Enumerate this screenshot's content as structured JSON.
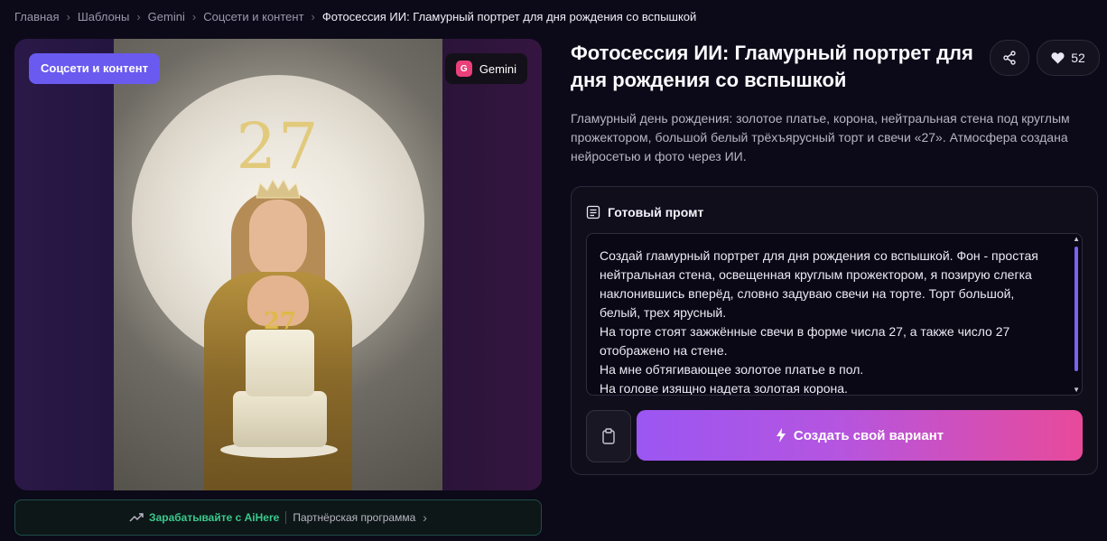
{
  "breadcrumb": {
    "items": [
      "Главная",
      "Шаблоны",
      "Gemini",
      "Соцсети и контент"
    ],
    "current": "Фотосессия ИИ: Гламурный портрет для дня рождения со вспышкой"
  },
  "media": {
    "category_badge": "Соцсети и контент",
    "model_icon_letter": "G",
    "model_name": "Gemini",
    "wall_number": "27",
    "candle_number": "27"
  },
  "affiliate": {
    "link": "Зарабатывайте с AiHere",
    "program": "Партнёрская программа"
  },
  "template": {
    "title": "Фотосессия ИИ: Гламурный портрет для дня рождения со вспышкой",
    "likes": "52",
    "description": "Гламурный день рождения: золотое платье, корона, нейтральная стена под круглым прожектором, большой белый трёхъярусный торт и свечи «27». Атмосфера создана нейросетью и фото через ИИ."
  },
  "prompt": {
    "heading": "Готовый промт",
    "text": "Создай гламурный портрет для дня рождения со вспышкой. Фон - простая нейтральная стена, освещенная круглым прожектором, я позирую слегка наклонившись вперёд, словно задуваю свечи на торте. Торт большой, белый, трех ярусный.\nНа торте стоят зажжённые свечи в форме числа 27, а также число 27 отображено на стене.\nНа мне обтягивающее золотое платье в пол.\nНа голове изящно надета золотая корона.",
    "create_button": "Создать свой вариант"
  },
  "icons": {
    "share": "share-icon",
    "like": "heart-icon",
    "prompt": "document-icon",
    "copy": "clipboard-icon",
    "create": "lightning-icon",
    "affiliate": "trend-up-icon"
  },
  "colors": {
    "accent_purple": "#6a5af0",
    "gradient_start": "#9b56f2",
    "gradient_end": "#e84a9a",
    "affiliate_green": "#39c98d"
  }
}
